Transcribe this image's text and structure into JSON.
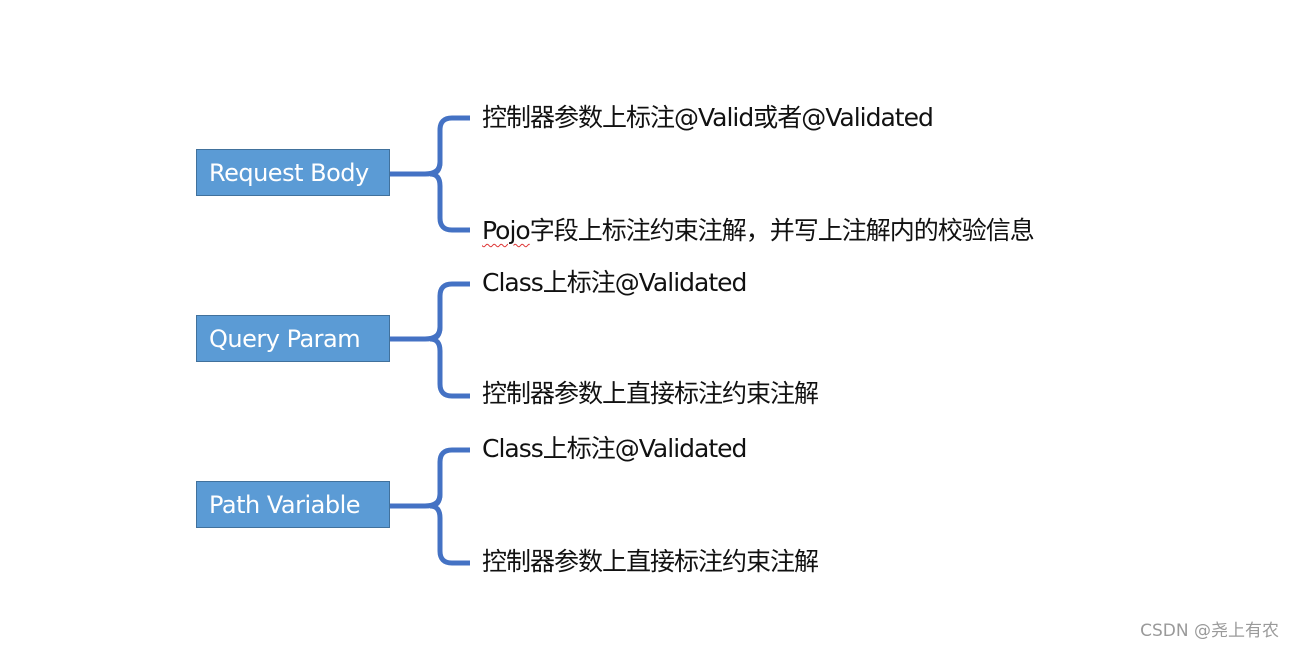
{
  "diagram": {
    "line_color": "#4472c4",
    "box_color": "#5b9bd5",
    "groups": [
      {
        "label": "Request Body",
        "items": [
          {
            "prefix": "",
            "text": "控制器参数上标注@Valid或者@Validated"
          },
          {
            "prefix": "Pojo",
            "text": "字段上标注约束注解，并写上注解内的校验信息"
          }
        ]
      },
      {
        "label": "Query Param",
        "items": [
          {
            "prefix": "",
            "text": "Class上标注@Validated"
          },
          {
            "prefix": "",
            "text": "控制器参数上直接标注约束注解"
          }
        ]
      },
      {
        "label": "Path Variable",
        "items": [
          {
            "prefix": "",
            "text": "Class上标注@Validated"
          },
          {
            "prefix": "",
            "text": "控制器参数上直接标注约束注解"
          }
        ]
      }
    ]
  },
  "watermark": "CSDN @尧上有农"
}
